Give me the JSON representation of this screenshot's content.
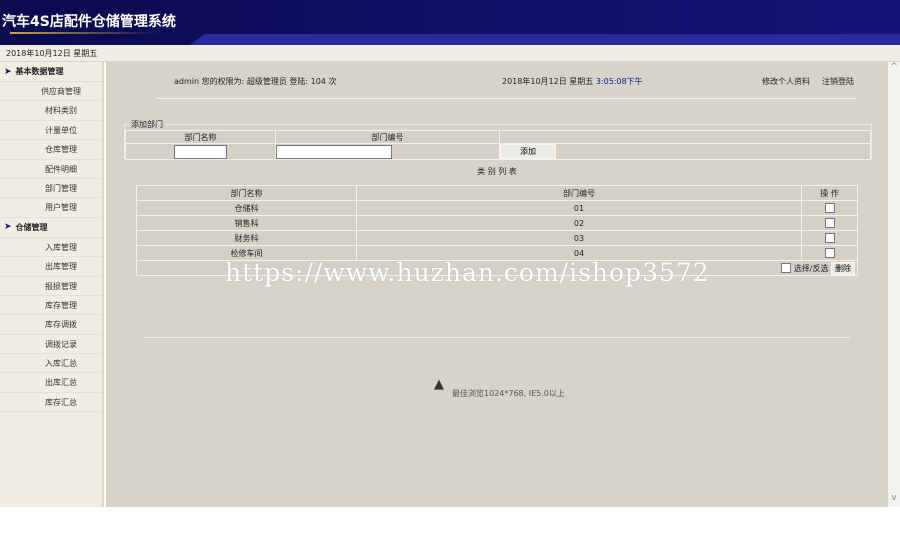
{
  "header": {
    "title": "汽车4S店配件仓储管理系统"
  },
  "datebar": {
    "date": "2018年10月12日 星期五"
  },
  "sidebar": {
    "groups": [
      {
        "label": "基本数据管理",
        "items": [
          "供应商管理",
          "材料类别",
          "计量单位",
          "仓库管理",
          "配件明细",
          "部门管理",
          "用户管理"
        ]
      },
      {
        "label": "仓储管理",
        "items": [
          "入库管理",
          "出库管理",
          "报损管理",
          "库存管理",
          "库存调拨",
          "调拨记录",
          "入库汇总",
          "出库汇总",
          "库存汇总"
        ]
      }
    ]
  },
  "topinfo": {
    "user": "admin 您的权限为: 超级管理员 登陆: 104 次",
    "date": "2018年10月12日 星期五",
    "time": "3:05:08下午",
    "edit_profile": "修改个人资料",
    "logout": "注销登陆"
  },
  "add_form": {
    "legend": "添加部门",
    "col_name": "部门名称",
    "col_code": "部门编号",
    "name_value": "",
    "code_value": "",
    "add_label": "添加"
  },
  "list": {
    "title": "类 别 列 表",
    "headers": [
      "部门名称",
      "部门编号",
      "操 作"
    ],
    "rows": [
      {
        "name": "仓储科",
        "code": "01"
      },
      {
        "name": "销售科",
        "code": "02"
      },
      {
        "name": "财务科",
        "code": "03"
      },
      {
        "name": "检修车间",
        "code": "04"
      }
    ],
    "select_label": "选择/反选",
    "delete_label": "删除"
  },
  "footer": {
    "note": "最佳浏览1024*768, IE5.0以上"
  },
  "watermark": "https://www.huzhan.com/ishop3572"
}
